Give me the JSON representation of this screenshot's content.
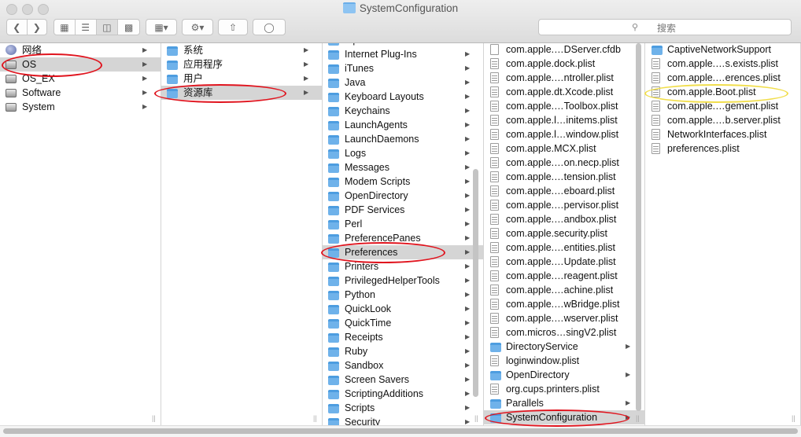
{
  "window": {
    "title": "SystemConfiguration",
    "search_placeholder": "搜索",
    "search_icon": "magnifier-icon",
    "toolbar_icons": [
      "back-icon",
      "forward-icon",
      "icon-view-icon",
      "list-view-icon",
      "column-view-icon",
      "cover-flow-icon",
      "arrange-icon",
      "gear-icon",
      "share-icon",
      "tag-icon"
    ]
  },
  "colors": {
    "selection": "#d5d5d5",
    "folder": "#6fb2ea",
    "annotation_red": "#e0141e",
    "annotation_yellow": "#f1de4c"
  },
  "columns": [
    {
      "items": [
        {
          "label": "网络",
          "icon": "globe-icon",
          "arrow": true
        },
        {
          "label": "OS",
          "icon": "drive-icon",
          "arrow": true,
          "selected": true
        },
        {
          "label": "OS_EX",
          "icon": "drive-icon",
          "arrow": true
        },
        {
          "label": "Software",
          "icon": "drive-icon",
          "arrow": true
        },
        {
          "label": "System",
          "icon": "drive-icon",
          "arrow": true
        }
      ]
    },
    {
      "items": [
        {
          "label": "系统",
          "icon": "system-folder-icon",
          "arrow": true
        },
        {
          "label": "应用程序",
          "icon": "applications-folder-icon",
          "arrow": true
        },
        {
          "label": "用户",
          "icon": "users-folder-icon",
          "arrow": true
        },
        {
          "label": "资源库",
          "icon": "library-folder-icon",
          "arrow": true,
          "selected": true
        }
      ]
    },
    {
      "items": [
        {
          "label": "Input Methods",
          "icon": "folder-icon",
          "arrow": true
        },
        {
          "label": "Internet Plug-Ins",
          "icon": "folder-icon",
          "arrow": true
        },
        {
          "label": "iTunes",
          "icon": "folder-icon",
          "arrow": true
        },
        {
          "label": "Java",
          "icon": "folder-icon",
          "arrow": true
        },
        {
          "label": "Keyboard Layouts",
          "icon": "folder-icon",
          "arrow": true
        },
        {
          "label": "Keychains",
          "icon": "folder-icon",
          "arrow": true
        },
        {
          "label": "LaunchAgents",
          "icon": "folder-icon",
          "arrow": true
        },
        {
          "label": "LaunchDaemons",
          "icon": "folder-icon",
          "arrow": true
        },
        {
          "label": "Logs",
          "icon": "folder-icon",
          "arrow": true
        },
        {
          "label": "Messages",
          "icon": "folder-icon",
          "arrow": true
        },
        {
          "label": "Modem Scripts",
          "icon": "folder-icon",
          "arrow": true
        },
        {
          "label": "OpenDirectory",
          "icon": "folder-icon",
          "arrow": true
        },
        {
          "label": "PDF Services",
          "icon": "folder-icon",
          "arrow": true
        },
        {
          "label": "Perl",
          "icon": "folder-icon",
          "arrow": true
        },
        {
          "label": "PreferencePanes",
          "icon": "folder-icon",
          "arrow": true
        },
        {
          "label": "Preferences",
          "icon": "folder-icon",
          "arrow": true,
          "selected": true
        },
        {
          "label": "Printers",
          "icon": "folder-icon",
          "arrow": true
        },
        {
          "label": "PrivilegedHelperTools",
          "icon": "folder-icon",
          "arrow": true
        },
        {
          "label": "Python",
          "icon": "folder-icon",
          "arrow": true
        },
        {
          "label": "QuickLook",
          "icon": "folder-icon",
          "arrow": true
        },
        {
          "label": "QuickTime",
          "icon": "folder-icon",
          "arrow": true
        },
        {
          "label": "Receipts",
          "icon": "folder-icon",
          "arrow": true
        },
        {
          "label": "Ruby",
          "icon": "folder-icon",
          "arrow": true
        },
        {
          "label": "Sandbox",
          "icon": "folder-icon",
          "arrow": true
        },
        {
          "label": "Screen Savers",
          "icon": "folder-icon",
          "arrow": true
        },
        {
          "label": "ScriptingAdditions",
          "icon": "folder-icon",
          "arrow": true
        },
        {
          "label": "Scripts",
          "icon": "folder-icon",
          "arrow": true
        },
        {
          "label": "Security",
          "icon": "folder-icon",
          "arrow": true
        }
      ]
    },
    {
      "items": [
        {
          "label": "com.apple.…DServer.cfdb",
          "icon": "file-icon",
          "arrow": false
        },
        {
          "label": "com.apple.dock.plist",
          "icon": "plist-icon",
          "arrow": false
        },
        {
          "label": "com.apple.…ntroller.plist",
          "icon": "plist-icon",
          "arrow": false
        },
        {
          "label": "com.apple.dt.Xcode.plist",
          "icon": "plist-icon",
          "arrow": false
        },
        {
          "label": "com.apple.…Toolbox.plist",
          "icon": "plist-icon",
          "arrow": false
        },
        {
          "label": "com.apple.l…initems.plist",
          "icon": "plist-icon",
          "arrow": false
        },
        {
          "label": "com.apple.l…window.plist",
          "icon": "plist-icon",
          "arrow": false
        },
        {
          "label": "com.apple.MCX.plist",
          "icon": "plist-icon",
          "arrow": false
        },
        {
          "label": "com.apple.…on.necp.plist",
          "icon": "plist-icon",
          "arrow": false
        },
        {
          "label": "com.apple.…tension.plist",
          "icon": "plist-icon",
          "arrow": false
        },
        {
          "label": "com.apple.…eboard.plist",
          "icon": "plist-icon",
          "arrow": false
        },
        {
          "label": "com.apple.…pervisor.plist",
          "icon": "plist-icon",
          "arrow": false
        },
        {
          "label": "com.apple.…andbox.plist",
          "icon": "plist-icon",
          "arrow": false
        },
        {
          "label": "com.apple.security.plist",
          "icon": "plist-icon",
          "arrow": false
        },
        {
          "label": "com.apple.…entities.plist",
          "icon": "plist-icon",
          "arrow": false
        },
        {
          "label": "com.apple.…Update.plist",
          "icon": "plist-icon",
          "arrow": false
        },
        {
          "label": "com.apple.…reagent.plist",
          "icon": "plist-icon",
          "arrow": false
        },
        {
          "label": "com.apple.…achine.plist",
          "icon": "plist-icon",
          "arrow": false
        },
        {
          "label": "com.apple.…wBridge.plist",
          "icon": "plist-icon",
          "arrow": false
        },
        {
          "label": "com.apple.…wserver.plist",
          "icon": "plist-icon",
          "arrow": false
        },
        {
          "label": "com.micros…singV2.plist",
          "icon": "plist-icon",
          "arrow": false
        },
        {
          "label": "DirectoryService",
          "icon": "folder-icon",
          "arrow": true
        },
        {
          "label": "loginwindow.plist",
          "icon": "plist-icon",
          "arrow": false
        },
        {
          "label": "OpenDirectory",
          "icon": "folder-icon",
          "arrow": true
        },
        {
          "label": "org.cups.printers.plist",
          "icon": "plist-icon",
          "arrow": false
        },
        {
          "label": "Parallels",
          "icon": "folder-icon",
          "arrow": true
        },
        {
          "label": "SystemConfiguration",
          "icon": "folder-icon",
          "arrow": true,
          "selected": true
        }
      ]
    },
    {
      "items": [
        {
          "label": "CaptiveNetworkSupport",
          "icon": "folder-icon",
          "arrow": false
        },
        {
          "label": "com.apple.…s.exists.plist",
          "icon": "plist-icon",
          "arrow": false
        },
        {
          "label": "com.apple.…erences.plist",
          "icon": "plist-icon",
          "arrow": false
        },
        {
          "label": "com.apple.Boot.plist",
          "icon": "plist-icon",
          "arrow": false
        },
        {
          "label": "com.apple.…gement.plist",
          "icon": "plist-icon",
          "arrow": false
        },
        {
          "label": "com.apple.…b.server.plist",
          "icon": "plist-icon",
          "arrow": false
        },
        {
          "label": "NetworkInterfaces.plist",
          "icon": "plist-icon",
          "arrow": false
        },
        {
          "label": "preferences.plist",
          "icon": "plist-icon",
          "arrow": false
        }
      ]
    }
  ]
}
